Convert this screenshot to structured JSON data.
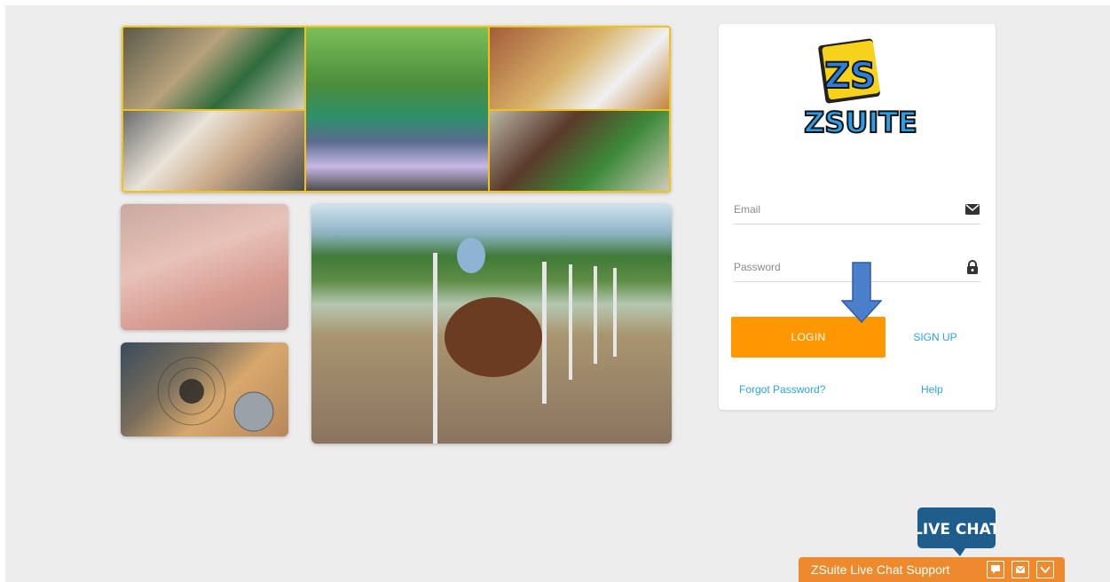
{
  "colors": {
    "accent_orange": "#ff9800",
    "link_blue": "#2aa3e8",
    "chat_orange": "#ee8a2e",
    "chat_badge_blue": "#1f5d8c",
    "collage_border": "#f3c21a"
  },
  "logo": {
    "line1": "ZS",
    "line2": "ZSUITE"
  },
  "login_form": {
    "email_label": "Email",
    "password_label": "Password",
    "email_icon": "envelope-icon",
    "password_icon": "lock-icon",
    "login_label": "LOGIN",
    "signup_label": "SIGN UP",
    "forgot_label": "Forgot Password?",
    "help_label": "Help"
  },
  "live_chat": {
    "badge_text": "LIVE CHAT",
    "bar_title": "ZSuite Live Chat Support",
    "buttons": [
      "chat-bubble-icon",
      "envelope-icon",
      "chevron-down-icon"
    ]
  }
}
